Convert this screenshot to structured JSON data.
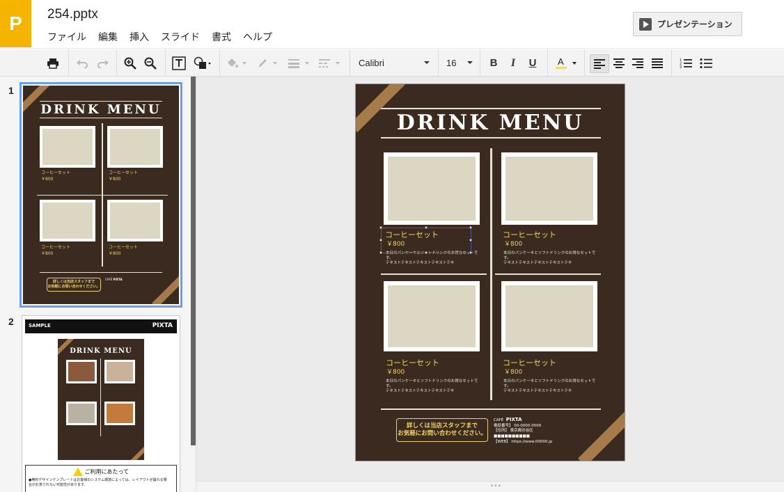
{
  "app": {
    "logo_letter": "P",
    "file_name": "254.pptx",
    "present_label": "プレゼンテーション"
  },
  "menu": [
    "ファイル",
    "編集",
    "挿入",
    "スライド",
    "書式",
    "ヘルプ"
  ],
  "toolbar": {
    "font_name": "Calibri",
    "font_size": "16",
    "text_color": "#f5d76e"
  },
  "slides_panel": {
    "numbers": [
      "1",
      "2"
    ]
  },
  "slide1": {
    "title": "DRINK MENU",
    "items": [
      {
        "name": "コーヒーセット",
        "price": "￥800",
        "desc1": "本日のパンケーキとソフトドリンクのお得なセットです。",
        "desc2": "テキストテキストテキストテキストテキ"
      },
      {
        "name": "コーヒーセット",
        "price": "￥800",
        "desc1": "本日のパンケーキとソフトドリンクのお得なセットです。",
        "desc2": "テキストテキストテキストテキストテキ"
      },
      {
        "name": "コーヒーセット",
        "price": "￥800",
        "desc1": "本日のパンケーキとソフトドリンクのお得なセットです。",
        "desc2": "テキストテキストテキストテキストテキ"
      },
      {
        "name": "コーヒーセット",
        "price": "￥800",
        "desc1": "本日のパンケーキとソフトドリンクのお得なセットです。",
        "desc2": "テキストテキストテキストテキストテキ"
      }
    ],
    "info_line1": "詳しくは当店スタッフまで",
    "info_line2": "お気軽にお問い合わせください。",
    "cafe_label": "CAFÉ",
    "cafe_name": "PIXTA",
    "cafe_tel": "電話番号】 00-0000-0000",
    "cafe_addr": "【住所】 東京都渋谷区",
    "cafe_blocks": "■■■■■■■■■■",
    "cafe_web": "【WEB】 https://www.00000.jp"
  },
  "slide2": {
    "sample_label": "SAMPLE",
    "brand": "PIXTA",
    "notice_title": "ご利用にあたって",
    "notice_line1": "●無料デザインテンプレートはお客様のシステム環境によっては、レイアウトが崩れる場",
    "notice_line2": "合がお意されない可能性があります。"
  },
  "colors": {
    "accent_blue": "#6a9ee8",
    "logo_orange": "#f5b400",
    "menu_gold": "#f2d36b"
  }
}
